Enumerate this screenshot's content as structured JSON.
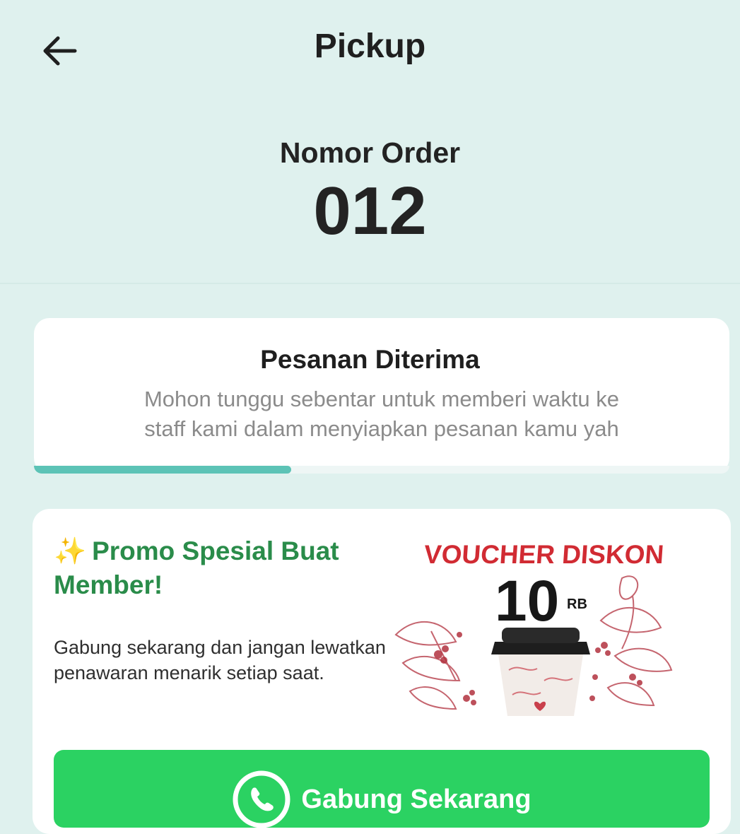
{
  "header": {
    "back_icon": "arrow-left-icon",
    "title": "Pickup"
  },
  "order": {
    "label": "Nomor Order",
    "number": "012"
  },
  "status": {
    "title": "Pesanan Diterima",
    "description_line1": "Mohon tunggu sebentar untuk memberi waktu ke",
    "description_line2": "staff kami dalam menyiapkan pesanan kamu yah",
    "progress": 0.37
  },
  "promo": {
    "sparkle": "✨",
    "title": "Promo Spesial Buat Member!",
    "description": "Gabung sekarang dan jangan lewatkan penawaran menarik setiap saat.",
    "voucher": {
      "headline": "VOUCHER DISKON",
      "amount": "10",
      "unit": "RB"
    },
    "button_label": "Gabung Sekarang",
    "button_icon": "whatsapp-icon"
  },
  "colors": {
    "background": "#dff1ee",
    "accent": "#5cc3b6",
    "promo_title": "#2a8c4a",
    "button": "#2bd262",
    "voucher_red": "#d12b33"
  }
}
